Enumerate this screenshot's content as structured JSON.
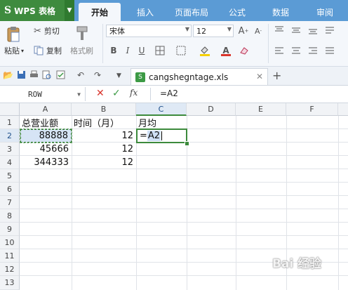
{
  "app": {
    "brand": "WPS 表格",
    "brand_icon": "S"
  },
  "menu_tabs": [
    "开始",
    "插入",
    "页面布局",
    "公式",
    "数据",
    "审阅"
  ],
  "ribbon": {
    "paste_label": "粘贴",
    "cut_label": "剪切",
    "copy_label": "复制",
    "format_painter_label": "格式刷",
    "font_name": "宋体",
    "font_size": "12",
    "bold": "B",
    "italic": "I",
    "underline": "U",
    "font_color_letter": "A"
  },
  "document": {
    "filename": "cangshegntage.xls"
  },
  "formula_bar": {
    "name_box": "ROW",
    "content": "=A2"
  },
  "columns": [
    "A",
    "B",
    "C",
    "D",
    "E",
    "F"
  ],
  "rows": [
    "1",
    "2",
    "3",
    "4",
    "5",
    "6",
    "7",
    "8",
    "9",
    "10",
    "11",
    "12",
    "13"
  ],
  "cells": {
    "A1": "总营业额",
    "B1": "时间（月）",
    "C1": "月均",
    "A2": "88888",
    "B2": "12",
    "C2_eq": "=",
    "C2_ref": "A2",
    "A3": "45666",
    "B3": "12",
    "A4": "344333",
    "B4": "12"
  },
  "active_cell": "C2",
  "accent_color": "#3c8a3c",
  "watermark": "Bai 经验"
}
